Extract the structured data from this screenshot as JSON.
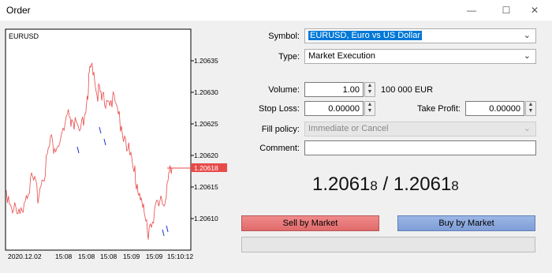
{
  "window": {
    "title": "Order",
    "minimize_glyph": "—",
    "maximize_glyph": "☐",
    "close_glyph": "✕"
  },
  "chart": {
    "symbol": "EURUSD",
    "current_price_label": "1.20618",
    "y_ticks": [
      "1.20635",
      "1.20630",
      "1.20625",
      "1.20620",
      "1.20615",
      "1.20610"
    ],
    "x_ticks": [
      "2020.12.02",
      "15:08",
      "15:08",
      "15:08",
      "15:09",
      "15:09",
      "15:10:12"
    ],
    "colors": {
      "up": "#e84a4a",
      "down": "#2233cc",
      "price_tag": "#e84a4a"
    }
  },
  "form": {
    "symbol_label": "Symbol:",
    "symbol_value": "EURUSD, Euro vs US Dollar",
    "type_label": "Type:",
    "type_value": "Market Execution",
    "volume_label": "Volume:",
    "volume_value": "1.00",
    "volume_unit": "100 000 EUR",
    "stop_loss_label": "Stop Loss:",
    "stop_loss_value": "0.00000",
    "take_profit_label": "Take Profit:",
    "take_profit_value": "0.00000",
    "fill_policy_label": "Fill policy:",
    "fill_policy_value": "Immediate or Cancel",
    "comment_label": "Comment:",
    "comment_value": ""
  },
  "quote": {
    "bid_main": "1.2061",
    "bid_small": "8",
    "separator": " / ",
    "ask_main": "1.2061",
    "ask_small": "8"
  },
  "buttons": {
    "sell": "Sell by Market",
    "buy": "Buy by Market"
  }
}
